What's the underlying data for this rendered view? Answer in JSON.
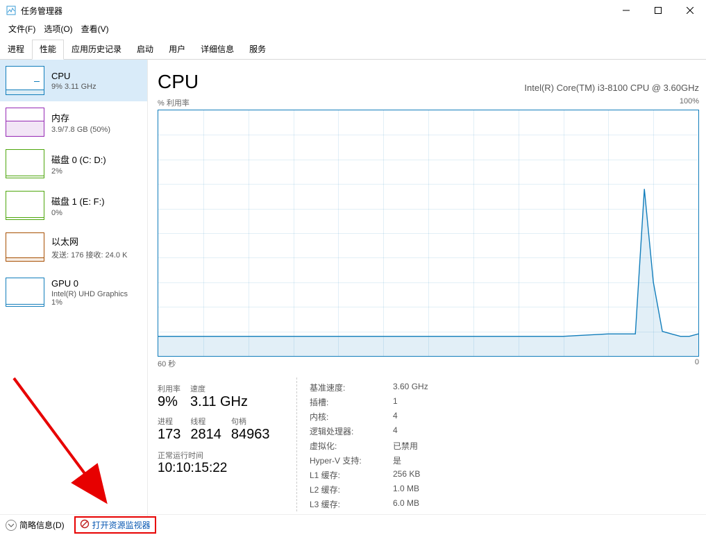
{
  "window": {
    "title": "任务管理器"
  },
  "menus": {
    "file": "文件(F)",
    "options": "选项(O)",
    "view": "查看(V)"
  },
  "tabs": [
    "进程",
    "性能",
    "应用历史记录",
    "启动",
    "用户",
    "详细信息",
    "服务"
  ],
  "active_tab": "性能",
  "sidebar": {
    "items": [
      {
        "title": "CPU",
        "subtitle": "9% 3.11 GHz"
      },
      {
        "title": "内存",
        "subtitle": "3.9/7.8 GB (50%)"
      },
      {
        "title": "磁盘 0 (C: D:)",
        "subtitle": "2%"
      },
      {
        "title": "磁盘 1 (E: F:)",
        "subtitle": "0%"
      },
      {
        "title": "以太网",
        "subtitle": "发送: 176  接收: 24.0 K"
      },
      {
        "title": "GPU 0",
        "subtitle": "Intel(R) UHD Graphics\n1%"
      }
    ]
  },
  "pane": {
    "title": "CPU",
    "device": "Intel(R) Core(TM) i3-8100 CPU @ 3.60GHz",
    "yaxis_label": "% 利用率",
    "yaxis_max": "100%",
    "xaxis_left": "60 秒",
    "xaxis_right": "0"
  },
  "stats_left": {
    "util_label": "利用率",
    "util_val": "9%",
    "speed_label": "速度",
    "speed_val": "3.11 GHz",
    "proc_label": "进程",
    "proc_val": "173",
    "threads_label": "线程",
    "threads_val": "2814",
    "handles_label": "句柄",
    "handles_val": "84963",
    "uptime_label": "正常运行时间",
    "uptime_val": "10:10:15:22"
  },
  "stats_right": [
    {
      "k": "基准速度:",
      "v": "3.60 GHz"
    },
    {
      "k": "插槽:",
      "v": "1"
    },
    {
      "k": "内核:",
      "v": "4"
    },
    {
      "k": "逻辑处理器:",
      "v": "4"
    },
    {
      "k": "虚拟化:",
      "v": "已禁用"
    },
    {
      "k": "Hyper-V 支持:",
      "v": "是"
    },
    {
      "k": "L1 缓存:",
      "v": "256 KB"
    },
    {
      "k": "L2 缓存:",
      "v": "1.0 MB"
    },
    {
      "k": "L3 缓存:",
      "v": "6.0 MB"
    }
  ],
  "footer": {
    "less_details": "简略信息(D)",
    "open_resmon": "打开资源监视器"
  },
  "chart_data": {
    "type": "line",
    "title": "CPU % 利用率",
    "xlabel": "秒",
    "ylabel": "% 利用率",
    "ylim": [
      0,
      100
    ],
    "xlim": [
      60,
      0
    ],
    "x": [
      60,
      55,
      50,
      45,
      40,
      35,
      30,
      25,
      20,
      15,
      10,
      8,
      7,
      6,
      5,
      4,
      3,
      2,
      1,
      0
    ],
    "values": [
      8,
      8,
      8,
      8,
      8,
      8,
      8,
      8,
      8,
      8,
      9,
      9,
      9,
      68,
      30,
      10,
      9,
      8,
      8,
      9
    ],
    "grid": true
  },
  "colors": {
    "accent": "#117dbb",
    "mem": "#9528b4",
    "disk": "#4da60c",
    "eth": "#a74f01",
    "link": "#0a59b3",
    "anno": "#e70000"
  }
}
